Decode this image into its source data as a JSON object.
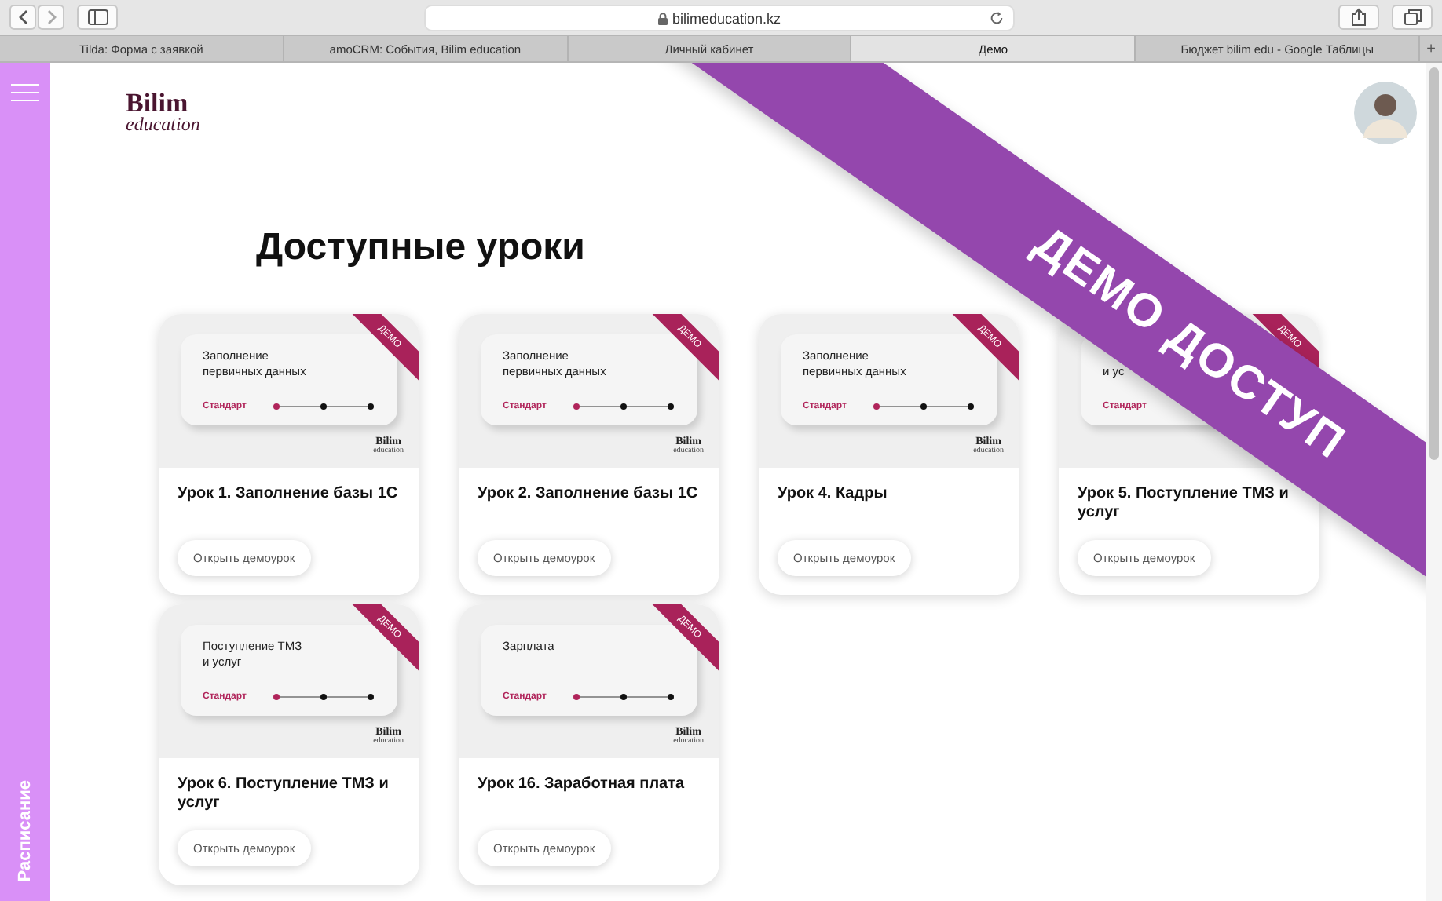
{
  "browser": {
    "url": "bilimeducation.kz",
    "tabs": [
      {
        "label": "Tilda: Форма с заявкой",
        "selected": false
      },
      {
        "label": "amoCRM: События, Bilim education",
        "selected": false
      },
      {
        "label": "Личный кабинет",
        "selected": false
      },
      {
        "label": "Демо",
        "selected": true
      },
      {
        "label": "Бюджет bilim edu - Google Таблицы",
        "selected": false
      }
    ],
    "new_tab": "+"
  },
  "sidebar": {
    "label": "Расписание"
  },
  "logo": {
    "name": "Bilim",
    "sub": "education"
  },
  "heading": "Доступные уроки",
  "banner": "ДЕМО ДОСТУП",
  "lessons": [
    {
      "inner_title": "Заполнение\nпервичных данных",
      "level": "Стандарт",
      "ribbon": "ДЕМО",
      "progress": true,
      "logo": [
        "Bilim",
        "education"
      ],
      "title": "Урок 1. Заполнение базы 1С",
      "button": "Открыть демоурок"
    },
    {
      "inner_title": "Заполнение\nпервичных данных",
      "level": "Стандарт",
      "ribbon": "ДЕМО",
      "progress": true,
      "logo": [
        "Bilim",
        "education"
      ],
      "title": "Урок 2. Заполнение базы 1С",
      "button": "Открыть демоурок"
    },
    {
      "inner_title": "Заполнение\nпервичных данных",
      "level": "Стандарт",
      "ribbon": "ДЕМО",
      "progress": true,
      "logo": [
        "Bilim",
        "education"
      ],
      "title": "Урок 4. Кадры",
      "button": "Открыть демоурок"
    },
    {
      "inner_title": "\nи ус",
      "level": "Стандарт",
      "ribbon": "ДЕМО",
      "progress": false,
      "title": "Урок 5. Поступление ТМЗ и услуг",
      "button": "Открыть демоурок"
    },
    {
      "inner_title": "Поступление ТМЗ\nи услуг",
      "level": "Стандарт",
      "ribbon": "ДЕМО",
      "progress": true,
      "logo": [
        "Bilim",
        "education"
      ],
      "title": "Урок 6. Поступление ТМЗ и услуг",
      "button": "Открыть демоурок"
    },
    {
      "inner_title": "Зарплата",
      "level": "Стандарт",
      "ribbon": "ДЕМО",
      "progress": true,
      "logo": [
        "Bilim",
        "education"
      ],
      "title": "Урок 16. Заработная плата",
      "button": "Открыть демоурок"
    }
  ]
}
